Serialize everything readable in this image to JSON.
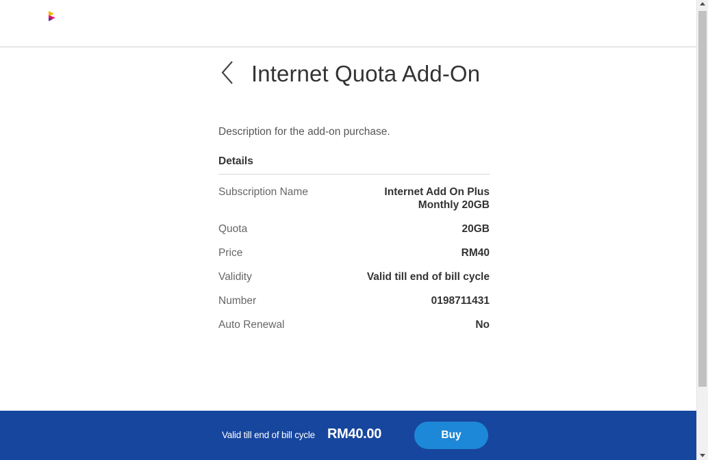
{
  "header": {
    "logo_icon": "brand-logo-icon"
  },
  "page": {
    "title": "Internet Quota Add-On",
    "back_icon": "chevron-left-icon",
    "description": "Description for the add-on purchase."
  },
  "details": {
    "heading": "Details",
    "rows": [
      {
        "label": "Subscription Name",
        "value_line1": "Internet Add On Plus",
        "value_line2": "Monthly 20GB"
      },
      {
        "label": "Quota",
        "value": "20GB"
      },
      {
        "label": "Price",
        "value": "RM40"
      },
      {
        "label": "Validity",
        "value": "Valid till end of bill cycle"
      },
      {
        "label": "Number",
        "value": "0198711431"
      },
      {
        "label": "Auto Renewal",
        "value": "No"
      }
    ]
  },
  "footer": {
    "validity": "Valid till end of bill cycle",
    "price": "RM40.00",
    "buy_label": "Buy"
  },
  "colors": {
    "footer_bg": "#17469e",
    "buy_button": "#1e88d8",
    "logo_yellow": "#f7b500",
    "logo_magenta": "#e2136e",
    "logo_purple": "#5b2c91"
  }
}
